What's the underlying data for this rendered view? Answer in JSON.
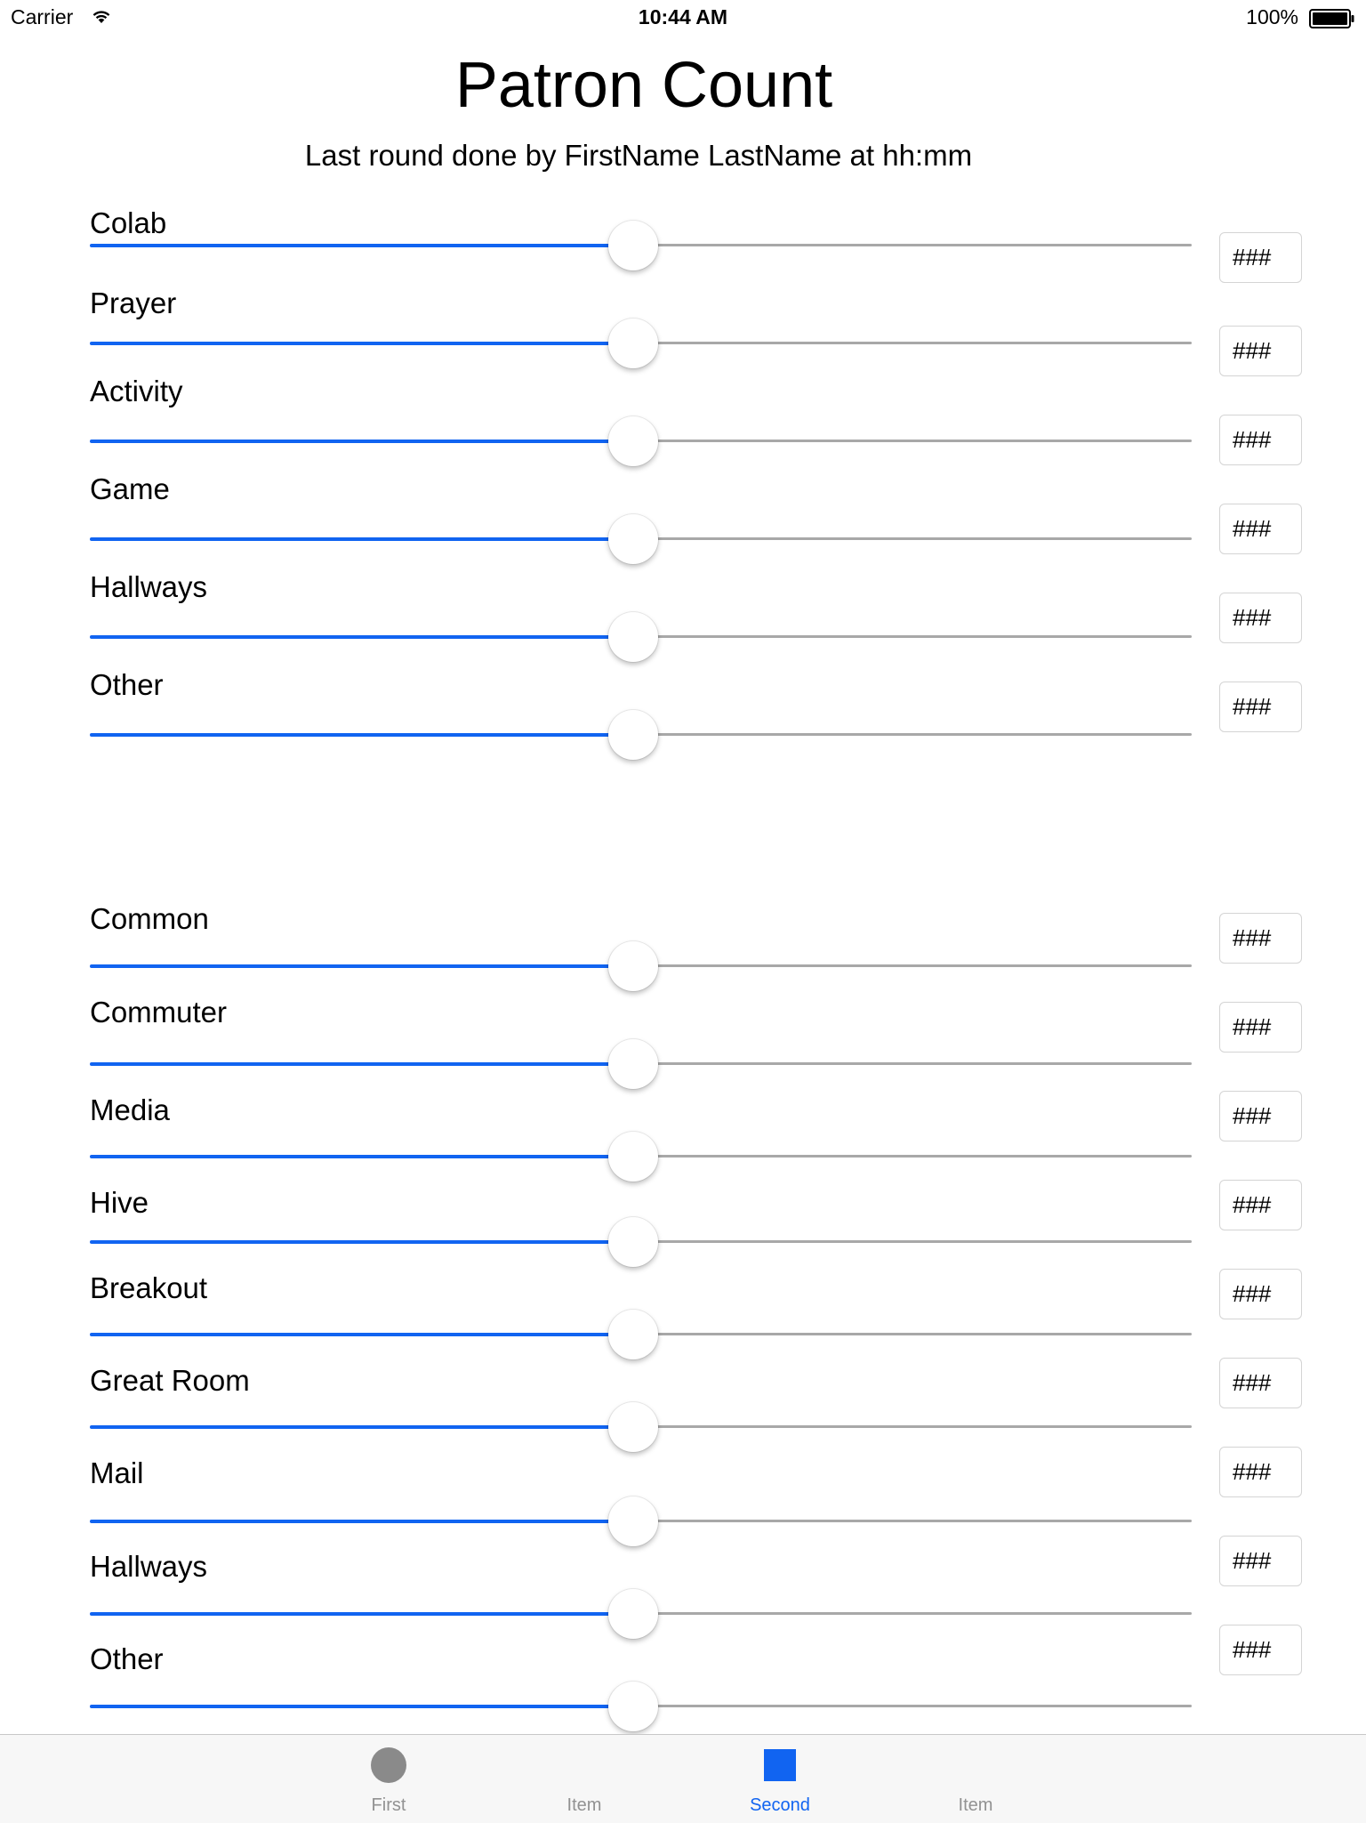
{
  "status_bar": {
    "carrier": "Carrier",
    "time": "10:44 AM",
    "battery": "100%"
  },
  "header": {
    "title": "Patron Count",
    "subtitle": "Last round done by FirstName LastName at hh:mm"
  },
  "section1": {
    "rows": [
      {
        "label": "Colab",
        "value_placeholder": "###",
        "slider_fraction": 0.5
      },
      {
        "label": "Prayer",
        "value_placeholder": "###",
        "slider_fraction": 0.5
      },
      {
        "label": "Activity",
        "value_placeholder": "###",
        "slider_fraction": 0.5
      },
      {
        "label": "Game",
        "value_placeholder": "###",
        "slider_fraction": 0.5
      },
      {
        "label": "Hallways",
        "value_placeholder": "###",
        "slider_fraction": 0.5
      },
      {
        "label": "Other",
        "value_placeholder": "###",
        "slider_fraction": 0.5
      }
    ]
  },
  "section2": {
    "rows": [
      {
        "label": "Common",
        "value_placeholder": "###",
        "slider_fraction": 0.5
      },
      {
        "label": "Commuter",
        "value_placeholder": "###",
        "slider_fraction": 0.5
      },
      {
        "label": "Media",
        "value_placeholder": "###",
        "slider_fraction": 0.5
      },
      {
        "label": "Hive",
        "value_placeholder": "###",
        "slider_fraction": 0.5
      },
      {
        "label": "Breakout",
        "value_placeholder": "###",
        "slider_fraction": 0.5
      },
      {
        "label": "Great Room",
        "value_placeholder": "###",
        "slider_fraction": 0.5
      },
      {
        "label": "Mail",
        "value_placeholder": "###",
        "slider_fraction": 0.5
      },
      {
        "label": "Hallways",
        "value_placeholder": "###",
        "slider_fraction": 0.5
      },
      {
        "label": "Other",
        "value_placeholder": "###",
        "slider_fraction": 0.5
      }
    ]
  },
  "tab_bar": {
    "items": [
      {
        "label": "First",
        "icon": "circle-icon",
        "active": false
      },
      {
        "label": "Item",
        "icon": "",
        "active": false
      },
      {
        "label": "Second",
        "icon": "square-icon",
        "active": true
      },
      {
        "label": "Item",
        "icon": "",
        "active": false
      }
    ]
  },
  "colors": {
    "accent": "#1164f1",
    "track_inactive": "#a8a8a8",
    "tab_inactive": "#929292",
    "tab_icon_inactive": "#8a8a8a"
  }
}
